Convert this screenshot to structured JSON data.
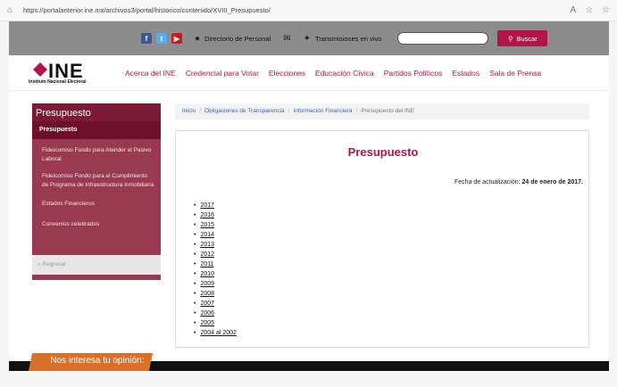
{
  "browser": {
    "url": "https://portalanterior.ine.mx/archivos3/portal/historico/contenido/XVIII_Presupuesto/"
  },
  "topbar": {
    "directory_label": "Directorio de Personal",
    "live_label": "Transmisiones en vivo",
    "search_placeholder": "",
    "search_button_label": "Buscar"
  },
  "header": {
    "logo_text": "INE",
    "logo_subtitle": "Instituto Nacional Electoral",
    "nav": [
      "Acerca del INE",
      "Credencial para Votar",
      "Elecciones",
      "Educación Cívica",
      "Partidos Políticos",
      "Estados",
      "Sala de Prensa"
    ]
  },
  "sidebar": {
    "title": "Presupuesto",
    "active_item": "Presupuesto",
    "items": [
      "Fideicomiso Fondo para Atender el Pasivo Laboral",
      "Fideicomiso Fondo para el Cumplimiento de Programa de Infraestructura Inmobiliaria",
      "Estados Financieros",
      "Convenios celebrados"
    ],
    "back_label": "« Regresar"
  },
  "breadcrumb": {
    "items": [
      "Inicio",
      "Obligaciones de Transparencia",
      "Información Financiera",
      "Presupuesto del INE"
    ]
  },
  "main": {
    "title": "Presupuesto",
    "update_label": "Fecha de actualización:",
    "update_date": "24 de enero de 2017.",
    "years": [
      "2017",
      "2016",
      "2015",
      "2014",
      "2013",
      "2012",
      "2011",
      "2010",
      "2009",
      "2008",
      "2007",
      "2006",
      "2005",
      "2004 al 2002"
    ]
  },
  "footer": {
    "opinion_label": "Nos interesa tu opinión:"
  },
  "colors": {
    "brand": "#b0144a",
    "sidebar": "#9a3a52",
    "topbar": "#8c8c8c",
    "opinion": "#d6702c"
  }
}
